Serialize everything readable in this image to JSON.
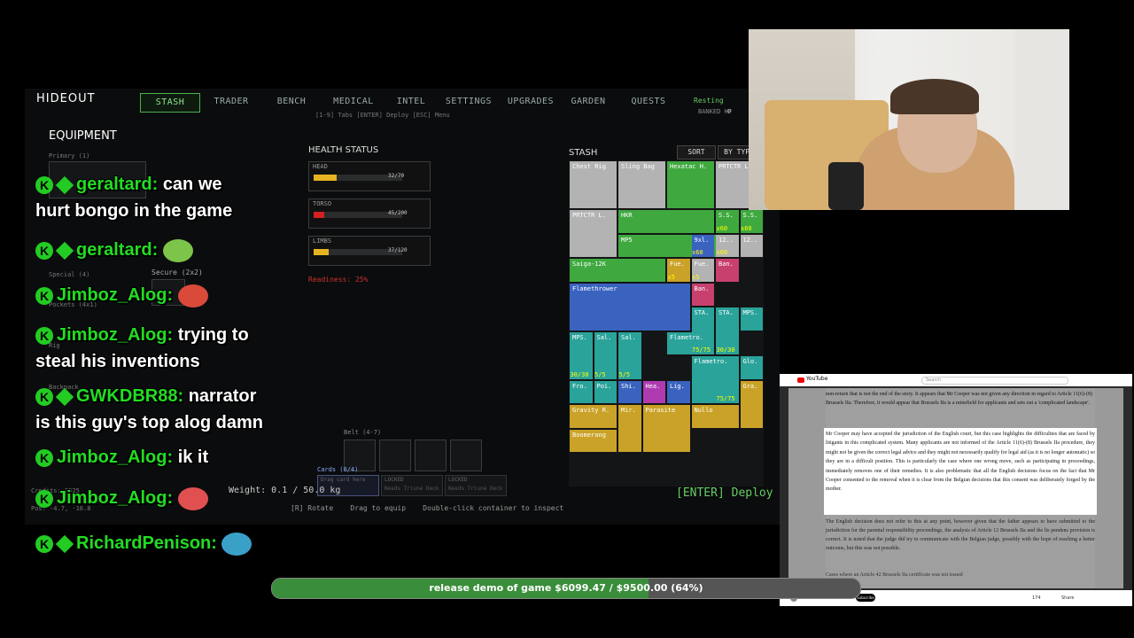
{
  "game": {
    "title": "HIDEOUT",
    "tabs": [
      {
        "label": "STASH",
        "active": true
      },
      {
        "label": "TRADER"
      },
      {
        "label": "BENCH"
      },
      {
        "label": "MEDICAL"
      },
      {
        "label": "INTEL"
      },
      {
        "label": "SETTINGS"
      },
      {
        "label": "UPGRADES"
      },
      {
        "label": "GARDEN"
      },
      {
        "label": "QUESTS"
      }
    ],
    "top_right_status": "Resting",
    "banked_hp": "BANKED HP",
    "banked_hp_value": "0",
    "help_line": "[1-9] Tabs  [ENTER] Deploy  [ESC] Menu",
    "equipment_title": "EQUIPMENT",
    "equip_labels": {
      "primary": "Primary (1)",
      "special": "Special (4)",
      "pockets": "Pockets (4x1)",
      "rig": "Rig",
      "backpack": "Backpack",
      "secure": "Secure (2x2)"
    },
    "health": {
      "title": "HEALTH STATUS",
      "parts": [
        {
          "name": "HEAD",
          "value": "32/70",
          "fraction": 0.46,
          "color": "#e6b422"
        },
        {
          "name": "TORSO",
          "value": "45/200",
          "fraction": 0.22,
          "color": "#d42020"
        },
        {
          "name": "LIMBS",
          "value": "37/120",
          "fraction": 0.31,
          "color": "#e6b422"
        }
      ],
      "readiness": "Readiness: 25%"
    },
    "belt_label": "Belt (4-7)",
    "cards_label": "Cards (0/4)",
    "card_slots": [
      {
        "top": "Drag card here",
        "bottom": ""
      },
      {
        "top": "LOCKED",
        "bottom": "Needs Triune Deck"
      },
      {
        "top": "LOCKED",
        "bottom": "Needs Triune Deck"
      }
    ],
    "weight": "Weight: 0.1 / 50.0 kg",
    "pos": "Pos: -4.7, -16.8",
    "credits": "Credits: 3825",
    "hints": "[R] Rotate    Drag to equip    Double-click container to inspect",
    "deploy": "[ENTER] Deploy",
    "stash": {
      "title": "STASH",
      "sort": "SORT",
      "by_type": "BY TYPE",
      "items": [
        {
          "label": "Chest Rig",
          "count": "",
          "color": "#b3b3b3"
        },
        {
          "label": "Sling Bag",
          "count": "",
          "color": "#b3b3b3"
        },
        {
          "label": "Hexatac H.",
          "count": "",
          "color": "#3fa93f"
        },
        {
          "label": "PRTCTR L.",
          "count": "",
          "color": "#b3b3b3"
        },
        {
          "label": "PRTCTR L.",
          "count": "",
          "color": "#b3b3b3"
        },
        {
          "label": "HKR",
          "count": "",
          "color": "#3fa93f"
        },
        {
          "label": "S.S.",
          "count": "x60",
          "color": "#3fa93f"
        },
        {
          "label": "S.S.",
          "count": "x60",
          "color": "#3fa93f"
        },
        {
          "label": "MP5",
          "count": "",
          "color": "#3fa93f"
        },
        {
          "label": "9xl.",
          "count": "x60",
          "color": "#3a63c0"
        },
        {
          "label": "12..",
          "count": "x60",
          "color": "#b3b3b3"
        },
        {
          "label": "12..",
          "count": "",
          "color": "#b3b3b3"
        },
        {
          "label": "Saiga-12K",
          "count": "",
          "color": "#3fa93f"
        },
        {
          "label": "Fue.",
          "count": "x5",
          "color": "#c9a227"
        },
        {
          "label": "Fue.",
          "count": "x5",
          "color": "#b3b3b3"
        },
        {
          "label": "Ban.",
          "count": "",
          "color": "#c8406e"
        },
        {
          "label": "Flamethrower",
          "count": "",
          "color": "#3a63c0"
        },
        {
          "label": "Ban.",
          "count": "",
          "color": "#c8406e"
        },
        {
          "label": "STA.",
          "count": "30/30",
          "color": "#2aa39a"
        },
        {
          "label": "STA.",
          "count": "30/30",
          "color": "#2aa39a"
        },
        {
          "label": "MPS.",
          "count": "",
          "color": "#2aa39a"
        },
        {
          "label": "MPS.",
          "count": "30/30",
          "color": "#2aa39a"
        },
        {
          "label": "Sal.",
          "count": "5/5",
          "color": "#2aa39a"
        },
        {
          "label": "Sal.",
          "count": "5/5",
          "color": "#2aa39a"
        },
        {
          "label": "Flametro.",
          "count": "75/75",
          "color": "#2aa39a"
        },
        {
          "label": "Flametro.",
          "count": "75/75",
          "color": "#2aa39a"
        },
        {
          "label": "Glo.",
          "count": "",
          "color": "#2aa39a"
        },
        {
          "label": "Fro.",
          "count": "",
          "color": "#2aa39a"
        },
        {
          "label": "Poi.",
          "count": "",
          "color": "#2aa39a"
        },
        {
          "label": "Shi.",
          "count": "",
          "color": "#3a63c0"
        },
        {
          "label": "Hea.",
          "count": "",
          "color": "#b03ab0"
        },
        {
          "label": "Lig.",
          "count": "",
          "color": "#3a63c0"
        },
        {
          "label": "Gra.",
          "count": "",
          "color": "#c9a227"
        },
        {
          "label": "Gravity R.",
          "count": "",
          "color": "#c9a227"
        },
        {
          "label": "Mir.",
          "count": "",
          "color": "#c9a227"
        },
        {
          "label": "Parasite",
          "count": "",
          "color": "#c9a227"
        },
        {
          "label": "Nullo",
          "count": "",
          "color": "#c9a227"
        },
        {
          "label": "Boomerang",
          "count": "",
          "color": "#c9a227"
        }
      ]
    }
  },
  "chat": [
    {
      "user": "geraltard:",
      "text": "can we",
      "text2": "hurt bongo in the game",
      "badges": 2
    },
    {
      "user": "geraltard:",
      "text": "",
      "emote": "frog-emote",
      "badges": 2
    },
    {
      "user": "Jimboz_Alog:",
      "text": "",
      "emote": "screaming-frog-emote",
      "badges": 1
    },
    {
      "user": "Jimboz_Alog:",
      "text": "trying to",
      "text2": "steal his inventions",
      "badges": 1
    },
    {
      "user": "GWKDBR88:",
      "text": "narrator",
      "text2": "is this guy's top alog damn",
      "badges": 2
    },
    {
      "user": "Jimboz_Alog:",
      "text": "ik it",
      "badges": 1
    },
    {
      "user": "Jimboz_Alog:",
      "text": "",
      "emote": "mario-emote",
      "badges": 1
    },
    {
      "user": "RichardPenison:",
      "text": "",
      "emote": "cortisol-emote",
      "badges": 2
    }
  ],
  "progress": {
    "label": "release demo of game $6099.47 / $9500.00 (64%)",
    "fraction": 0.64,
    "color": "#3a8d3a"
  },
  "doc": {
    "site": "YouTube",
    "search": "Search",
    "para_top": "non-return that is not the end of the story. It appears that Mr Cooper was not given any direction in regard to Article 11(6)-(8) Brussels IIa. Therefore, it would appear that Brussels IIa is a minefield for applicants and sets out a 'complicated landscape'.",
    "para_main": "Mr Cooper may have accepted the jurisdiction of the English court, but this case highlights the difficulties that are faced by litigants in this complicated system. Many applicants are not informed of the Article 11(6)-(8) Brussels IIa procedure, they might not be given the correct legal advice and they might not necessarily qualify for legal aid (as it is no longer automatic) so they are in a difficult position. This is particularly the case where one wrong move, such as participating in proceedings, immediately removes one of their remedies. It is also problematic that all the English decisions focus on the fact that Mr Cooper consented to the removal when it is clear from the Belgian decisions that this consent was deliberately forged by the mother.",
    "para_rest": "The English decision does not refer to this at any point, however given that the father appears to have submitted to the jurisdiction for the parental responsibility proceedings, the analysis of Article 12 Brussels IIa and the lis pendens provision is correct. It is noted that the judge did try to communicate with the Belgian judge, possibly with the hope of reaching a better outcome, but this was not possible.",
    "heading_next": "Cases where an Article 42 Brussels IIa certificate was not issued",
    "footer_channel": "",
    "subscribe": "Subscribe",
    "likes": "174",
    "share": "Share"
  },
  "colors": {
    "accent": "#4cb04c",
    "chat_user": "#22dd22"
  }
}
